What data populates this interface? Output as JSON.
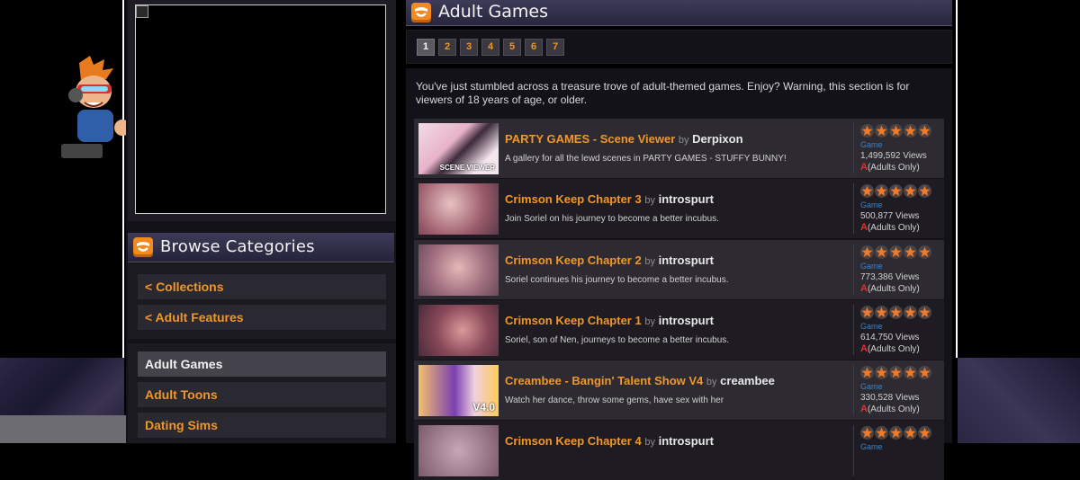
{
  "main": {
    "title": "Adult Games",
    "pages": [
      "1",
      "2",
      "3",
      "4",
      "5",
      "6",
      "7"
    ],
    "current_page": "1",
    "intro": "You've just stumbled across a treasure trove of adult-themed games. Enjoy? Warning, this section is for viewers of 18 years of age, or older."
  },
  "sidebar": {
    "title": "Browse Categories",
    "nav": [
      {
        "label": "< Collections"
      },
      {
        "label": "< Adult Features"
      }
    ],
    "categories": [
      {
        "label": "Adult Games",
        "active": true
      },
      {
        "label": "Adult Toons",
        "active": false
      },
      {
        "label": "Dating Sims",
        "active": false
      }
    ]
  },
  "games": [
    {
      "title": "PARTY GAMES - Scene Viewer",
      "by": "by",
      "author": "Derpixon",
      "desc": "A gallery for all the lewd scenes in PARTY GAMES - STUFFY BUNNY!",
      "type": "Game",
      "views": "1,499,592 Views",
      "rating": "(Adults Only)",
      "rating_icon": "A",
      "stars": 5,
      "thumb_text": "SCENE VIEWER"
    },
    {
      "title": "Crimson Keep Chapter 3",
      "by": "by",
      "author": "introspurt",
      "desc": "Join Soriel on his journey to become a better incubus.",
      "type": "Game",
      "views": "500,877 Views",
      "rating": "(Adults Only)",
      "rating_icon": "A",
      "stars": 5
    },
    {
      "title": "Crimson Keep Chapter 2",
      "by": "by",
      "author": "introspurt",
      "desc": "Soriel continues his journey to become a better incubus.",
      "type": "Game",
      "views": "773,386 Views",
      "rating": "(Adults Only)",
      "rating_icon": "A",
      "stars": 5
    },
    {
      "title": "Crimson Keep Chapter 1",
      "by": "by",
      "author": "introspurt",
      "desc": "Soriel, son of Nen, journeys to become a better incubus.",
      "type": "Game",
      "views": "614,750 Views",
      "rating": "(Adults Only)",
      "rating_icon": "A",
      "stars": 5
    },
    {
      "title": "Creambee - Bangin' Talent Show V4",
      "by": "by",
      "author": "creambee",
      "desc": "Watch her dance, throw some gems, have sex with her",
      "type": "Game",
      "views": "330,528 Views",
      "rating": "(Adults Only)",
      "rating_icon": "A",
      "stars": 5,
      "thumb_text": "V4.0"
    },
    {
      "title": "Crimson Keep Chapter 4",
      "by": "by",
      "author": "introspurt",
      "desc": "",
      "type": "Game",
      "views": "",
      "rating": "",
      "rating_icon": "",
      "stars": 5
    }
  ],
  "colors": {
    "accent": "#f0962a",
    "star": "#f07a2a",
    "type_link": "#3c82c8",
    "adult_badge": "#e42f2f"
  }
}
